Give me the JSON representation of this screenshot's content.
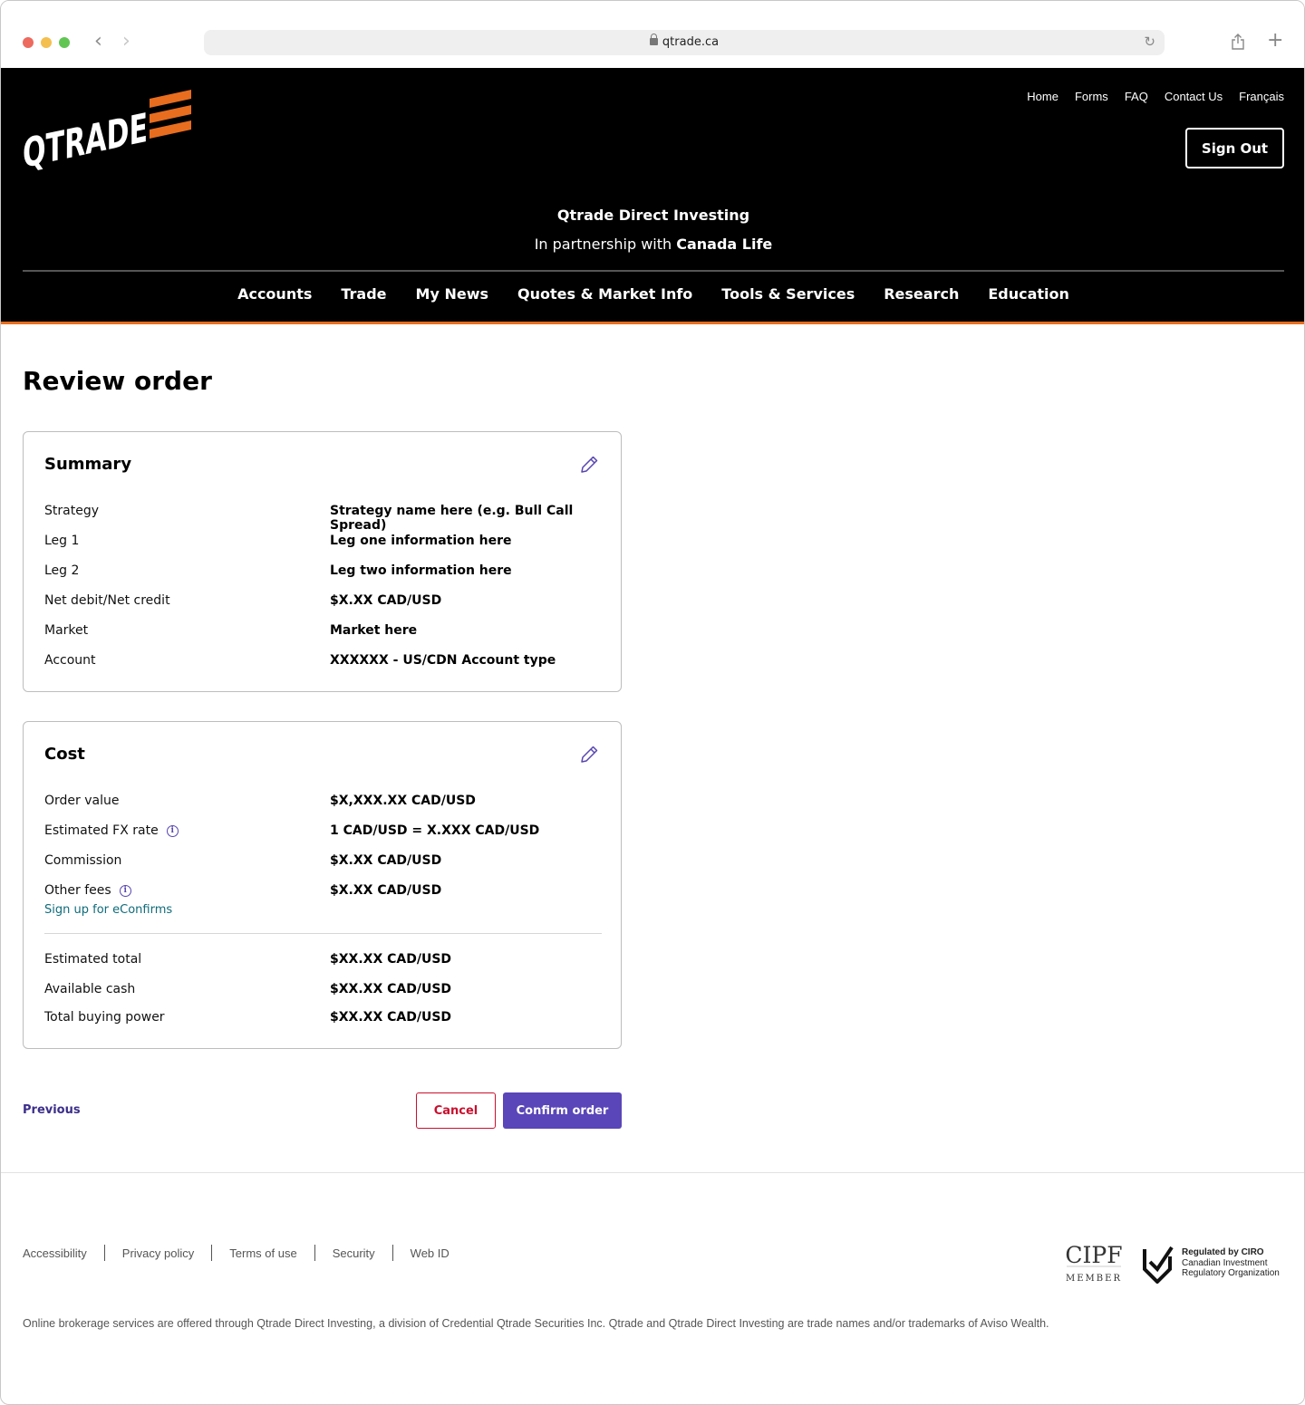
{
  "browser": {
    "url": "qtrade.ca"
  },
  "header": {
    "logo_text": "QTRADE",
    "util_nav": [
      "Home",
      "Forms",
      "FAQ",
      "Contact Us",
      "Français"
    ],
    "sign_out": "Sign Out",
    "brand_title": "Qtrade Direct Investing",
    "partnership_prefix": "In partnership with",
    "partnership_name": "Canada Life",
    "main_nav": [
      "Accounts",
      "Trade",
      "My News",
      "Quotes & Market Info",
      "Tools & Services",
      "Research",
      "Education"
    ]
  },
  "colors": {
    "accent_orange": "#e86d1f",
    "primary_purple": "#5a46b8",
    "cancel_red": "#c8102e",
    "link_teal": "#0f6b7a"
  },
  "page": {
    "title": "Review order"
  },
  "summary": {
    "title": "Summary",
    "rows": [
      {
        "label": "Strategy",
        "value": "Strategy name here (e.g. Bull Call Spread)"
      },
      {
        "label": "Leg 1",
        "value": "Leg one information here"
      },
      {
        "label": "Leg 2",
        "value": "Leg two information here"
      },
      {
        "label": "Net debit/Net credit",
        "value": "$X.XX CAD/USD"
      },
      {
        "label": "Market",
        "value": "Market here"
      },
      {
        "label": "Account",
        "value": "XXXXXX - US/CDN Account type"
      }
    ]
  },
  "cost": {
    "title": "Cost",
    "rows": [
      {
        "label": "Order value",
        "value": "$X,XXX.XX CAD/USD"
      },
      {
        "label": "Estimated FX rate",
        "value": "1 CAD/USD = X.XXX CAD/USD"
      },
      {
        "label": "Commission",
        "value": "$X.XX CAD/USD"
      },
      {
        "label": "Other fees",
        "value": "$X.XX CAD/USD"
      }
    ],
    "econfirms_link": "Sign up for eConfirms",
    "totals": [
      {
        "label": "Estimated total",
        "value": "$XX.XX CAD/USD"
      },
      {
        "label": "Available cash",
        "value": "$XX.XX CAD/USD"
      },
      {
        "label": "Total buying power",
        "value": "$XX.XX CAD/USD"
      }
    ]
  },
  "actions": {
    "previous": "Previous",
    "cancel": "Cancel",
    "confirm": "Confirm order"
  },
  "footer": {
    "links": [
      "Accessibility",
      "Privacy policy",
      "Terms of use",
      "Security",
      "Web ID"
    ],
    "cipf_text": "CIPF",
    "cipf_member": "MEMBER",
    "ciro_line1": "Regulated by CIRO",
    "ciro_line2": "Canadian Investment",
    "ciro_line3": "Regulatory Organization",
    "disclaimer": "Online brokerage services are offered through Qtrade Direct Investing, a division of Credential Qtrade Securities Inc. Qtrade and Qtrade Direct Investing are trade names and/or trademarks of Aviso Wealth."
  }
}
